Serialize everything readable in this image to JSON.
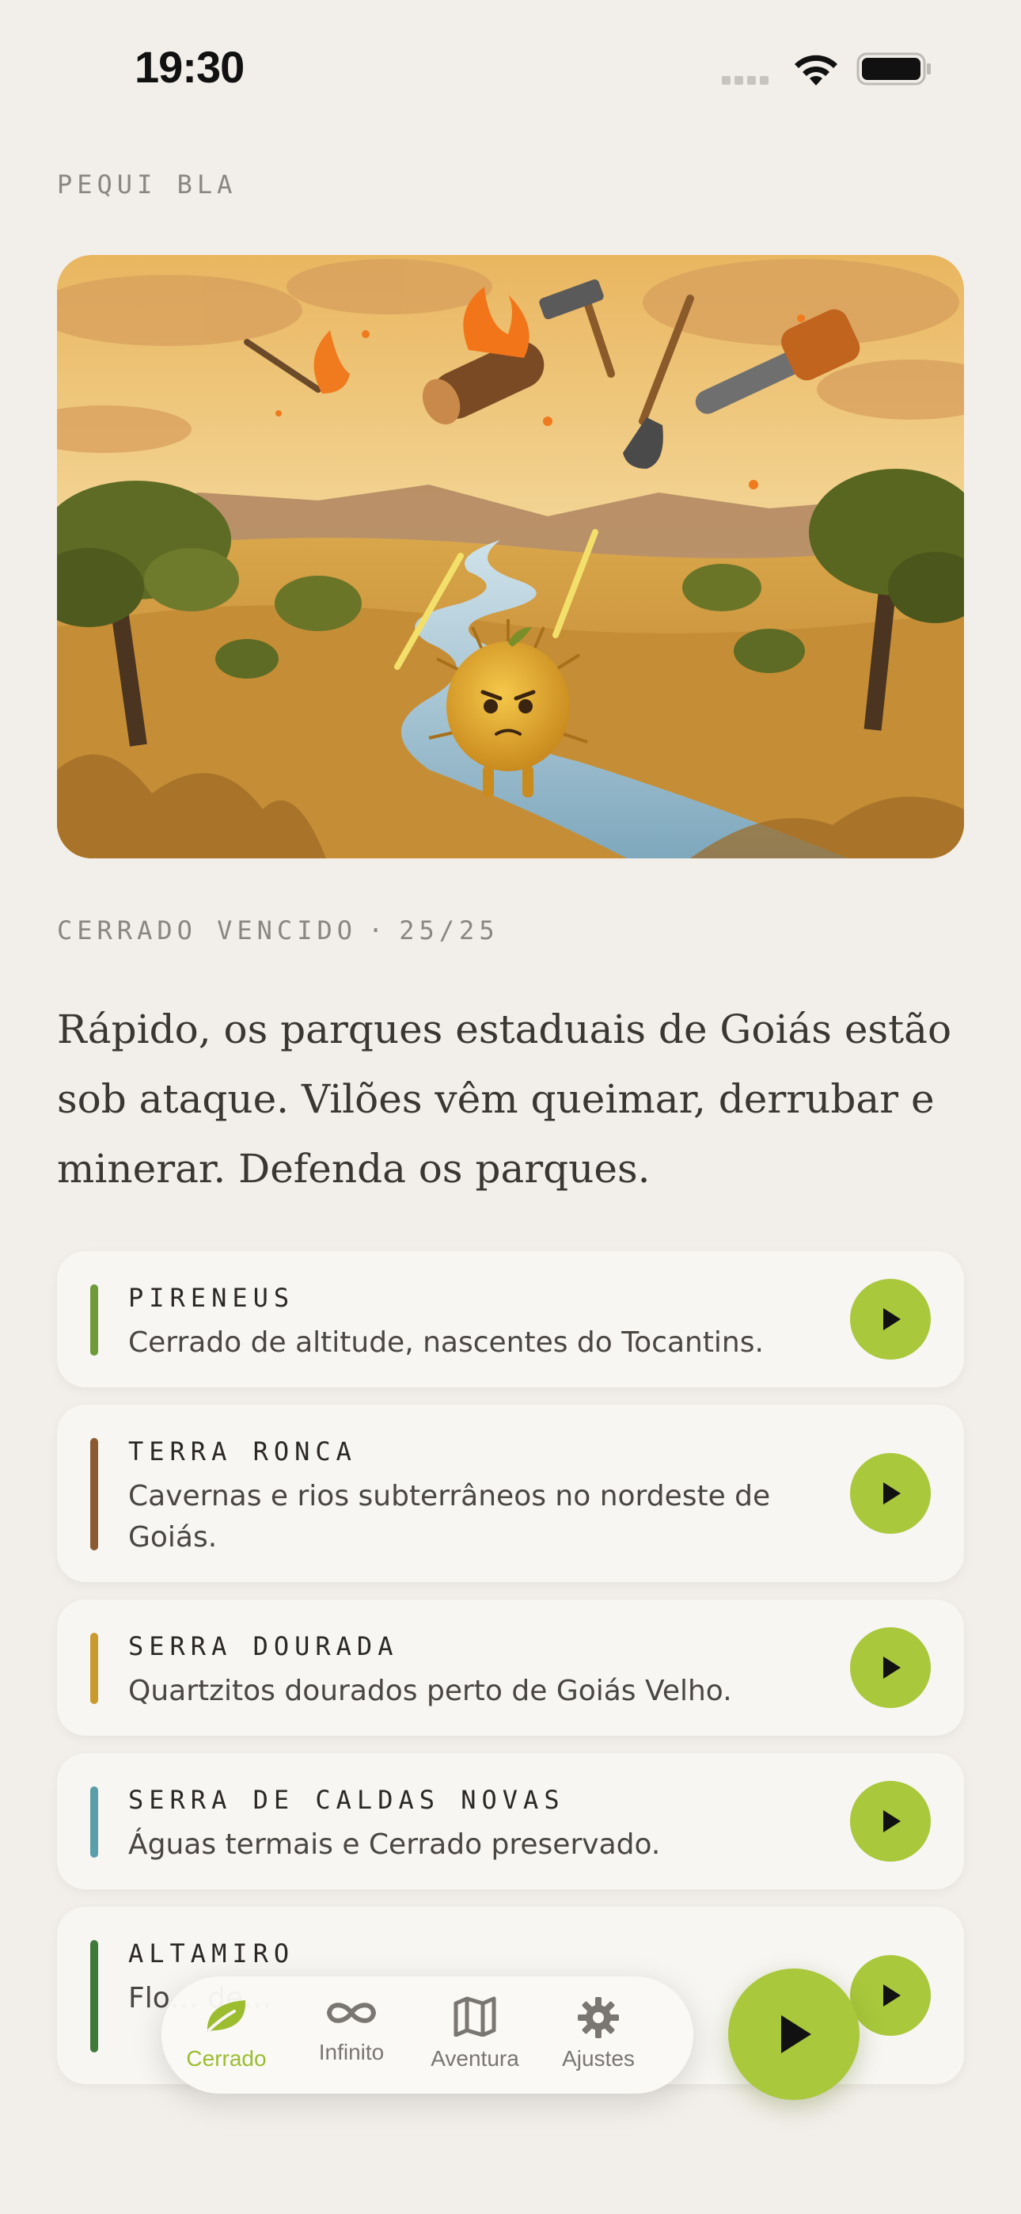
{
  "status_bar": {
    "time": "19:30"
  },
  "app": {
    "name": "PEQUI BLA"
  },
  "progress": {
    "label": "CERRADO VENCIDO",
    "separator": "·",
    "value": "25/25"
  },
  "intro": {
    "text": "Rápido, os parques estaduais de Goiás estão sob ataque. Vilões vêm queimar, derrubar e minerar. Defenda os parques."
  },
  "parks": [
    {
      "name": "PIRENEUS",
      "description": "Cerrado de altitude, nascentes do Tocantins.",
      "accent": "#6f9a3a"
    },
    {
      "name": "TERRA RONCA",
      "description": "Cavernas e rios subterrâneos no nordeste de Goiás.",
      "accent": "#8a5a32"
    },
    {
      "name": "SERRA DOURADA",
      "description": "Quartzitos dourados perto de Goiás Velho.",
      "accent": "#c99a2e"
    },
    {
      "name": "SERRA DE CALDAS NOVAS",
      "description": "Águas termais e Cerrado preservado.",
      "accent": "#5a9eaa"
    },
    {
      "name": "ALTAMIRO",
      "description": "Flo… de…",
      "accent": "#3f7a3a"
    }
  ],
  "tabs": [
    {
      "label": "Cerrado",
      "icon": "leaf-icon",
      "active": true
    },
    {
      "label": "Infinito",
      "icon": "infinity-icon",
      "active": false
    },
    {
      "label": "Aventura",
      "icon": "map-icon",
      "active": false
    },
    {
      "label": "Ajustes",
      "icon": "gear-icon",
      "active": false
    }
  ],
  "colors": {
    "accent": "#a9c83c",
    "background": "#f2efea",
    "card": "#f7f6f3"
  }
}
